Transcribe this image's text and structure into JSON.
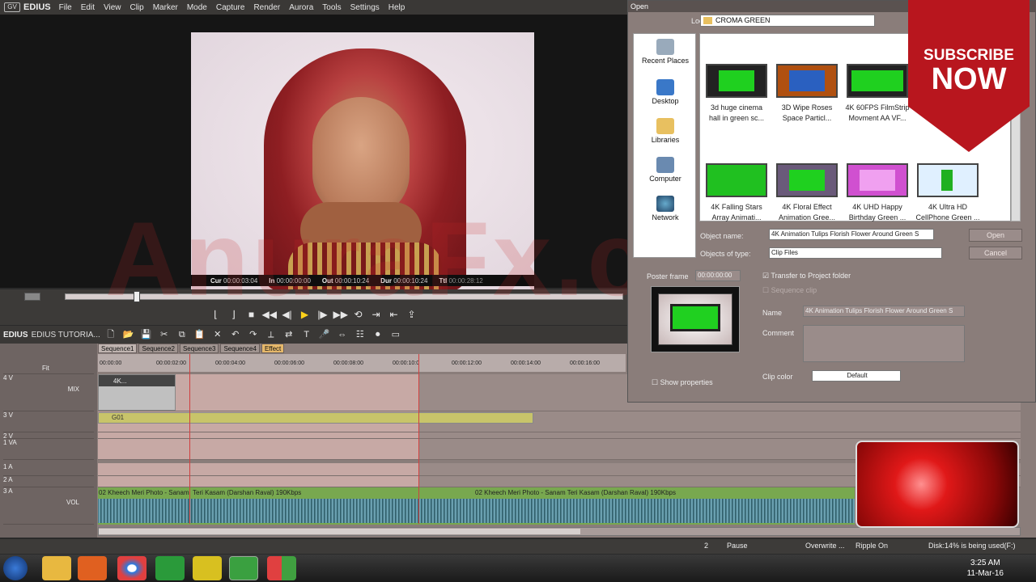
{
  "app": {
    "name": "EDIUS",
    "logo": "GV"
  },
  "menu": [
    "File",
    "Edit",
    "View",
    "Clip",
    "Marker",
    "Mode",
    "Capture",
    "Render",
    "Aurora",
    "Tools",
    "Settings",
    "Help"
  ],
  "timecodes": {
    "cur_label": "Cur",
    "cur": "00:00:03:04",
    "in_label": "In",
    "in": "00:00:00:00",
    "out_label": "Out",
    "out": "00:00:10:24",
    "dur_label": "Dur",
    "dur": "00:00:10:24",
    "ttl_label": "Ttl",
    "ttl": "00:00:28:12"
  },
  "timeline_toolbar": {
    "label": "EDIUS",
    "project": "EDIUS TUTORIA..."
  },
  "sequences": [
    "Sequence1",
    "Sequence2",
    "Sequence3",
    "Sequence4",
    "Effect"
  ],
  "ruler": [
    "00:00:00",
    "00:00:02:00",
    "00:00:04:00",
    "00:00:06:00",
    "00:00:08:00",
    "00:00:10:0",
    "00:00:12:00",
    "00:00:14:00",
    "00:00:16:00"
  ],
  "tracks": {
    "v4": "4 V",
    "v3": "3 V",
    "v2": "2 V",
    "va1": "1 VA",
    "a1": "1 A",
    "a2": "2 A",
    "a3": "3 A",
    "mix": "MIX",
    "vol": "VOL",
    "fit": "Fit"
  },
  "clips": {
    "v4_clip": "4K...",
    "title_clip": "G01",
    "audio1": "02 Kheech Meri Photo - Sanam",
    "audio2": "Teri Kasam (Darshan Raval) 190Kbps",
    "audio3": "02 Kheech Meri Photo - Sanam Teri Kasam (Darshan Raval) 190Kbps"
  },
  "status": {
    "count": "2",
    "mode": "Pause",
    "overwrite": "Overwrite ...",
    "ripple": "Ripple On",
    "disk": "Disk:14% is being used(F:)"
  },
  "clock": {
    "time": "3:25 AM",
    "date": "11-Mar-16"
  },
  "dialog": {
    "title": "Open",
    "look_in_label": "Look in:",
    "look_in": "CROMA GREEN",
    "places": [
      "Recent Places",
      "Desktop",
      "Libraries",
      "Computer",
      "Network"
    ],
    "files": [
      [
        "3d huge cinema",
        "hall in green sc..."
      ],
      [
        "3D Wipe Roses",
        "Space Particl..."
      ],
      [
        "4K 60FPS FilmStrip",
        "Movment AA VF..."
      ],
      [
        "4K Falling Stars",
        "Array Animati..."
      ],
      [
        "4K Floral Effect",
        "Animation Gree..."
      ],
      [
        "4K UHD Happy",
        "Birthday Green ..."
      ],
      [
        "4K Ultra HD",
        "CellPhone Green ..."
      ]
    ],
    "object_name_label": "Object name:",
    "object_name": "4K Animation Tulips Florish Flower Around Green S",
    "object_type_label": "Objects of type:",
    "object_type": "Clip Files",
    "open": "Open",
    "cancel": "Cancel",
    "poster_label": "Poster frame",
    "poster_tc": "00:00:00:00",
    "transfer": "Transfer to Project folder",
    "sequence_clip": "Sequence clip",
    "name_label": "Name",
    "name": "4K Animation Tulips Florish Flower Around Green S",
    "comment_label": "Comment",
    "clip_color_label": "Clip color",
    "clip_color": "Default",
    "show_props": "Show properties"
  },
  "overlay": {
    "sub1": "SUBSCRIBE",
    "sub2": "NOW",
    "watermark": "AnuraFx.com"
  }
}
